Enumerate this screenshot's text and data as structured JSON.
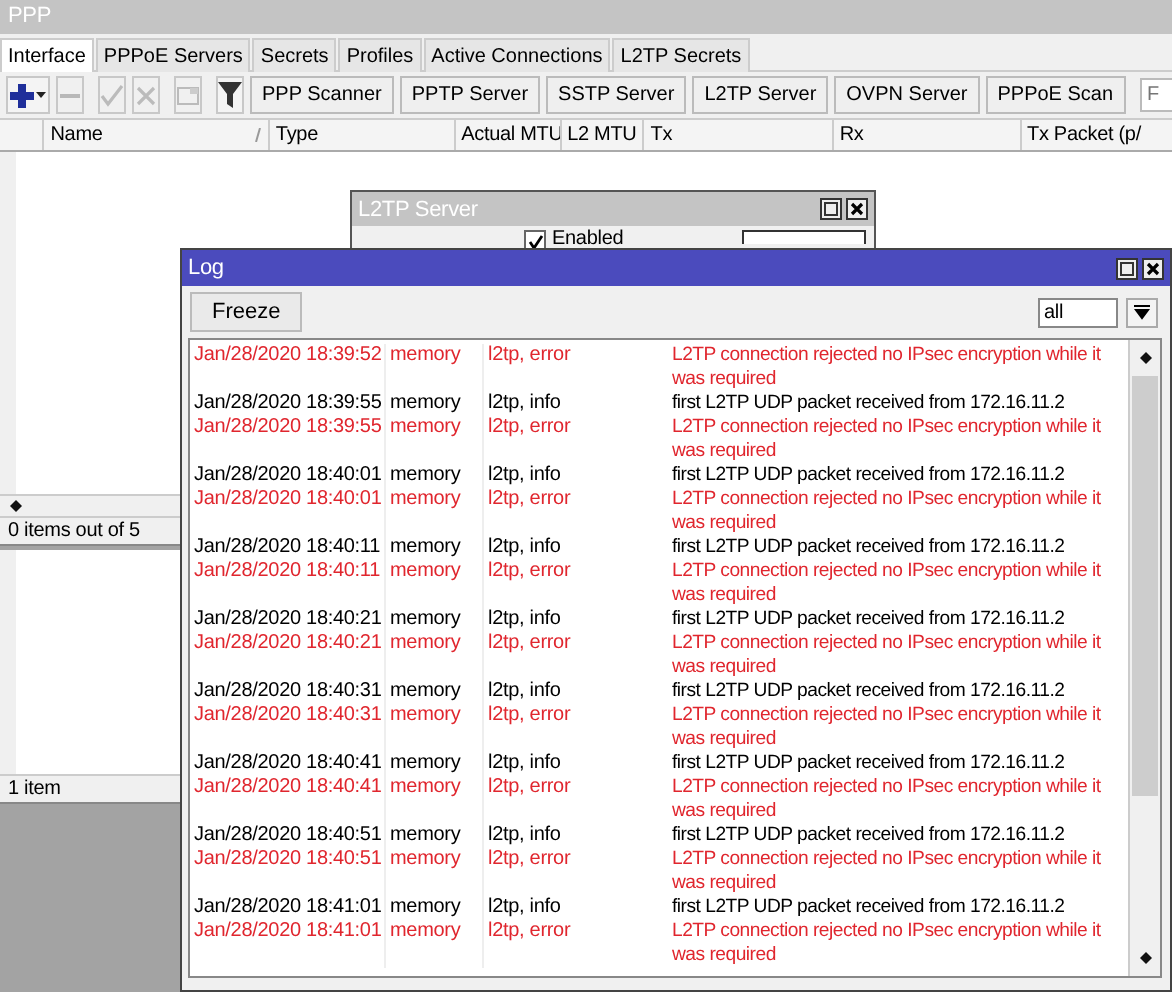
{
  "ppp_window": {
    "title": "PPP",
    "tabs": [
      {
        "label": "Interface",
        "selected": true
      },
      {
        "label": "PPPoE Servers",
        "selected": false
      },
      {
        "label": "Secrets",
        "selected": false
      },
      {
        "label": "Profiles",
        "selected": false
      },
      {
        "label": "Active Connections",
        "selected": false
      },
      {
        "label": "L2TP Secrets",
        "selected": false
      }
    ],
    "tool_buttons": [
      {
        "kind": "add",
        "disabled": false
      },
      {
        "kind": "remove",
        "disabled": true
      },
      {
        "kind": "enable",
        "disabled": true
      },
      {
        "kind": "disable",
        "disabled": true
      },
      {
        "kind": "comment",
        "disabled": true
      },
      {
        "kind": "filter",
        "disabled": false
      }
    ],
    "buttons": [
      "PPP Scanner",
      "PPTP Server",
      "SSTP Server",
      "L2TP Server",
      "OVPN Server",
      "PPPoE Scan"
    ],
    "find_field": {
      "placeholder": "F"
    },
    "columns": [
      "Name",
      "Type",
      "Actual MTU",
      "L2 MTU",
      "Tx",
      "Rx",
      "Tx Packet (p/"
    ],
    "status": "0 items out of 5",
    "lower_status": "1 item"
  },
  "l2tp_server_window": {
    "title": "L2TP Server",
    "enabled": {
      "label": "Enabled",
      "checked": true
    }
  },
  "log_window": {
    "title": "Log",
    "freeze_button": "Freeze",
    "filter": "all",
    "rows": [
      {
        "kind": "error",
        "date": "Jan/28/2020 18:39:52",
        "column_2": "memory",
        "column_3": "l2tp, error",
        "message": "L2TP connection rejected no IPsec encryption while it was required"
      },
      {
        "kind": "info",
        "date": "Jan/28/2020 18:39:55",
        "column_2": "memory",
        "column_3": "l2tp, info",
        "message": "first L2TP UDP packet received from 172.16.11.2"
      },
      {
        "kind": "error",
        "date": "Jan/28/2020 18:39:55",
        "column_2": "memory",
        "column_3": "l2tp, error",
        "message": "L2TP connection rejected no IPsec encryption while it was required"
      },
      {
        "kind": "info",
        "date": "Jan/28/2020 18:40:01",
        "column_2": "memory",
        "column_3": "l2tp, info",
        "message": "first L2TP UDP packet received from 172.16.11.2"
      },
      {
        "kind": "error",
        "date": "Jan/28/2020 18:40:01",
        "column_2": "memory",
        "column_3": "l2tp, error",
        "message": "L2TP connection rejected no IPsec encryption while it was required"
      },
      {
        "kind": "info",
        "date": "Jan/28/2020 18:40:11",
        "column_2": "memory",
        "column_3": "l2tp, info",
        "message": "first L2TP UDP packet received from 172.16.11.2"
      },
      {
        "kind": "error",
        "date": "Jan/28/2020 18:40:11",
        "column_2": "memory",
        "column_3": "l2tp, error",
        "message": "L2TP connection rejected no IPsec encryption while it was required"
      },
      {
        "kind": "info",
        "date": "Jan/28/2020 18:40:21",
        "column_2": "memory",
        "column_3": "l2tp, info",
        "message": "first L2TP UDP packet received from 172.16.11.2"
      },
      {
        "kind": "error",
        "date": "Jan/28/2020 18:40:21",
        "column_2": "memory",
        "column_3": "l2tp, error",
        "message": "L2TP connection rejected no IPsec encryption while it was required"
      },
      {
        "kind": "info",
        "date": "Jan/28/2020 18:40:31",
        "column_2": "memory",
        "column_3": "l2tp, info",
        "message": "first L2TP UDP packet received from 172.16.11.2"
      },
      {
        "kind": "error",
        "date": "Jan/28/2020 18:40:31",
        "column_2": "memory",
        "column_3": "l2tp, error",
        "message": "L2TP connection rejected no IPsec encryption while it was required"
      },
      {
        "kind": "info",
        "date": "Jan/28/2020 18:40:41",
        "column_2": "memory",
        "column_3": "l2tp, info",
        "message": "first L2TP UDP packet received from 172.16.11.2"
      },
      {
        "kind": "error",
        "date": "Jan/28/2020 18:40:41",
        "column_2": "memory",
        "column_3": "l2tp, error",
        "message": "L2TP connection rejected no IPsec encryption while it was required"
      },
      {
        "kind": "info",
        "date": "Jan/28/2020 18:40:51",
        "column_2": "memory",
        "column_3": "l2tp, info",
        "message": "first L2TP UDP packet received from 172.16.11.2"
      },
      {
        "kind": "error",
        "date": "Jan/28/2020 18:40:51",
        "column_2": "memory",
        "column_3": "l2tp, error",
        "message": "L2TP connection rejected no IPsec encryption while it was required"
      },
      {
        "kind": "info",
        "date": "Jan/28/2020 18:41:01",
        "column_2": "memory",
        "column_3": "l2tp, info",
        "message": "first L2TP UDP packet received from 172.16.11.2"
      },
      {
        "kind": "error",
        "date": "Jan/28/2020 18:41:01",
        "column_2": "memory",
        "column_3": "l2tp, error",
        "message": "L2TP connection rejected no IPsec encryption while it was required"
      }
    ]
  }
}
